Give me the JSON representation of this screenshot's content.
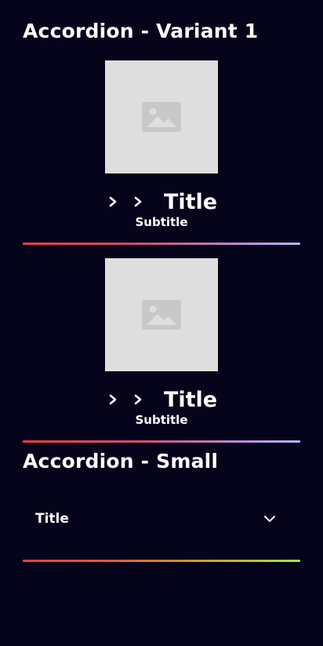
{
  "sections": {
    "variant1_title": "Accordion - Variant 1",
    "small_title": "Accordion - Small"
  },
  "accordion_variant1": {
    "items": [
      {
        "title": "Title",
        "subtitle": "Subtitle",
        "icon": "image-placeholder-icon",
        "chevrons": [
          "chevron-right-icon",
          "chevron-right-icon"
        ]
      },
      {
        "title": "Title",
        "subtitle": "Subtitle",
        "icon": "image-placeholder-icon",
        "chevrons": [
          "chevron-right-icon",
          "chevron-right-icon"
        ]
      }
    ]
  },
  "accordion_small": {
    "items": [
      {
        "title": "Title",
        "icon": "chevron-down-icon"
      }
    ]
  },
  "colors": {
    "background": "#05041a",
    "text": "#ffffff",
    "placeholder": "#dedede",
    "divider_v1_start": "#ef3e41",
    "divider_v1_end": "#b7b3f3",
    "divider_small_start": "#ef3e41",
    "divider_small_end": "#a8e43a"
  }
}
